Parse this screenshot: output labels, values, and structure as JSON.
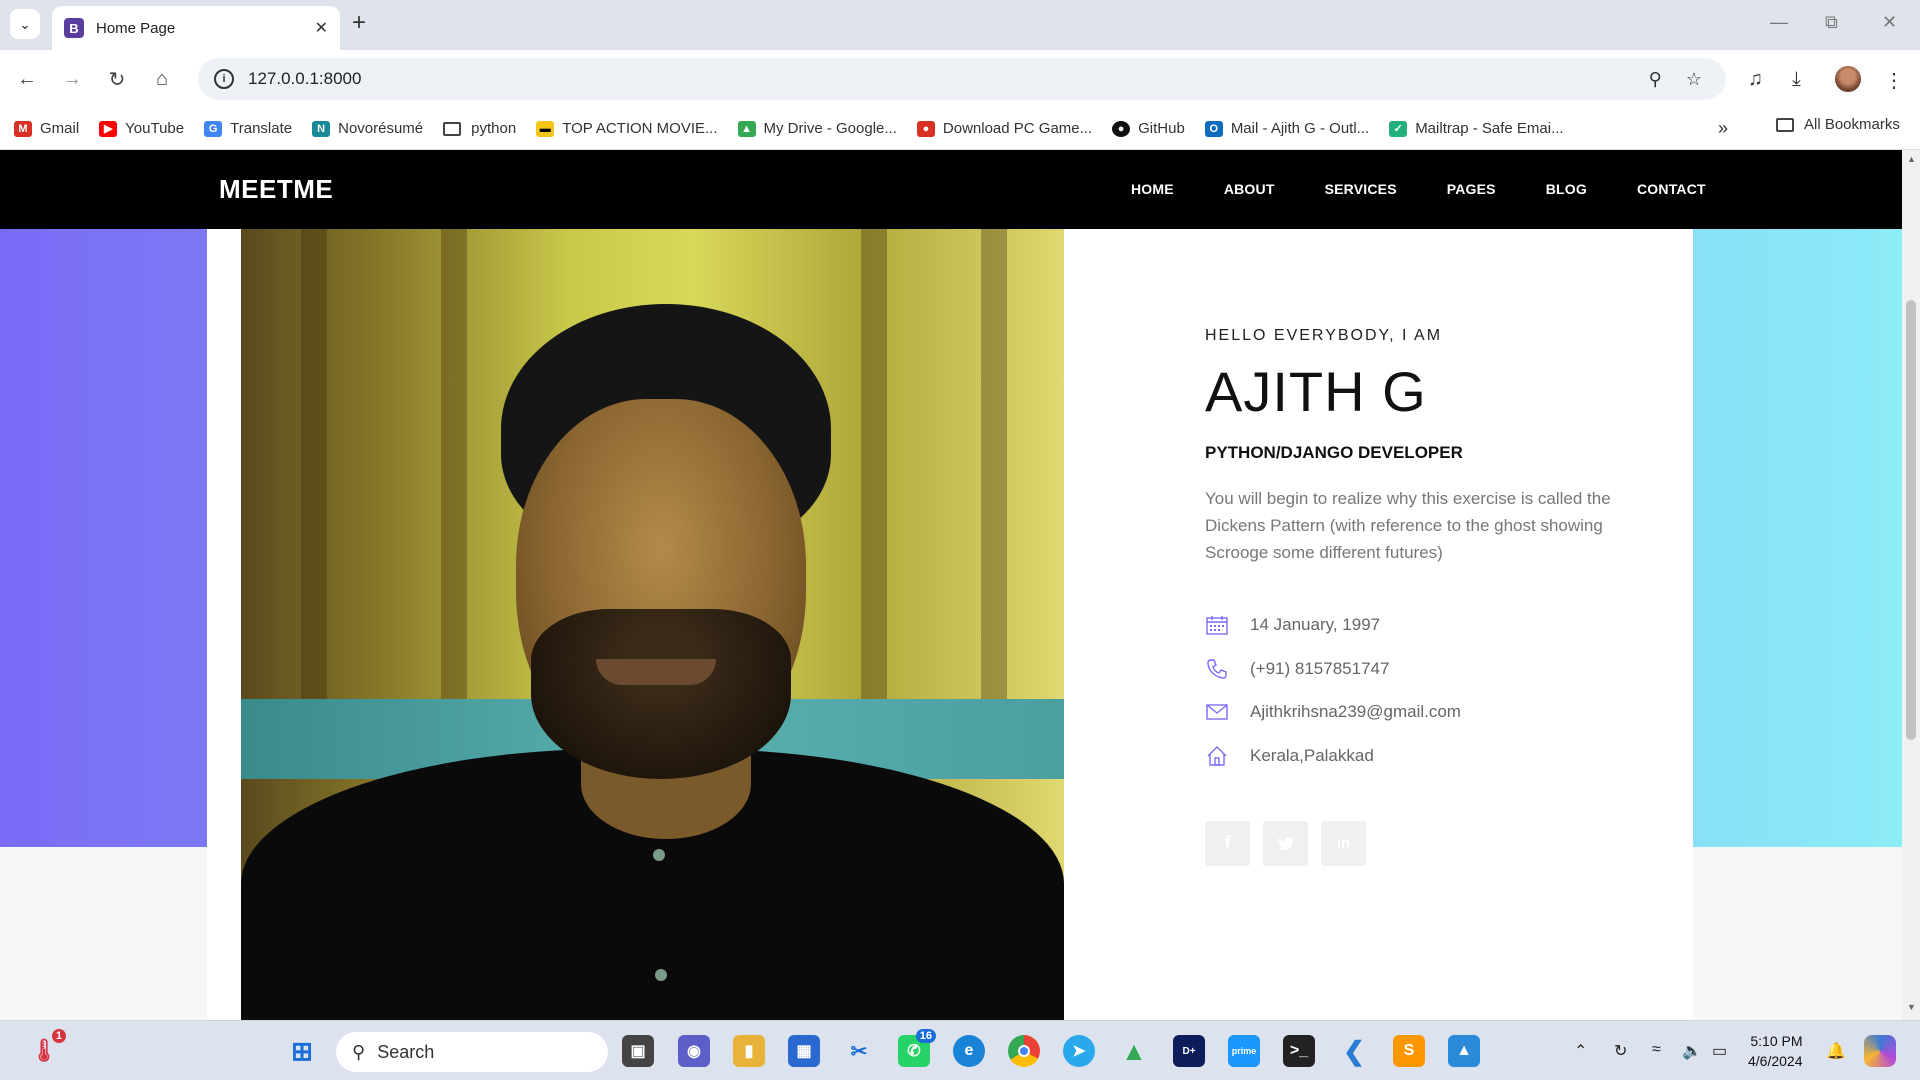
{
  "browser": {
    "tab_title": "Home Page",
    "tab_favicon": "B",
    "url": "127.0.0.1:8000",
    "bookmarks": [
      {
        "label": "Gmail",
        "icon": "gmail-icon",
        "color": "#d93025"
      },
      {
        "label": "YouTube",
        "icon": "youtube-icon",
        "color": "#ff0000"
      },
      {
        "label": "Translate",
        "icon": "translate-icon",
        "color": "#4285f4"
      },
      {
        "label": "Novorésumé",
        "icon": "novoresume-icon",
        "color": "#1a8a9a"
      },
      {
        "label": "python",
        "icon": "folder-icon",
        "color": "#444444"
      },
      {
        "label": "TOP ACTION MOVIE...",
        "icon": "imdb-icon",
        "color": "#f5c518"
      },
      {
        "label": "My Drive - Google...",
        "icon": "drive-icon",
        "color": "#34a853"
      },
      {
        "label": "Download PC Game...",
        "icon": "game-icon",
        "color": "#d93025"
      },
      {
        "label": "GitHub",
        "icon": "github-icon",
        "color": "#111111"
      },
      {
        "label": "Mail - Ajith G - Outl...",
        "icon": "outlook-icon",
        "color": "#0f6cbd"
      },
      {
        "label": "Mailtrap - Safe Emai...",
        "icon": "mailtrap-icon",
        "color": "#22b07d"
      }
    ],
    "all_bookmarks": "All Bookmarks"
  },
  "site": {
    "brand": "MEETME",
    "nav": [
      "HOME",
      "ABOUT",
      "SERVICES",
      "PAGES",
      "BLOG",
      "CONTACT"
    ],
    "greeting": "HELLO EVERYBODY, I AM",
    "name": "AJITH G",
    "role": "PYTHON/DJANGO DEVELOPER",
    "bio": "You will begin to realize why this exercise is called the Dickens Pattern (with reference to the ghost showing Scrooge some different futures)",
    "details": [
      {
        "icon": "calendar-icon",
        "text": "14 January, 1997"
      },
      {
        "icon": "phone-icon",
        "text": "(+91) 8157851747"
      },
      {
        "icon": "mail-icon",
        "text": "Ajithkrihsna239@gmail.com"
      },
      {
        "icon": "home-icon",
        "text": "Kerala,Palakkad"
      }
    ],
    "socials": [
      "facebook-icon",
      "twitter-icon",
      "linkedin-icon"
    ],
    "accent_color": "#7a6cf6"
  },
  "taskbar": {
    "search_label": "Search",
    "notification_badge": "1",
    "whatsapp_badge": "16",
    "time": "5:10 PM",
    "date": "4/6/2024"
  }
}
